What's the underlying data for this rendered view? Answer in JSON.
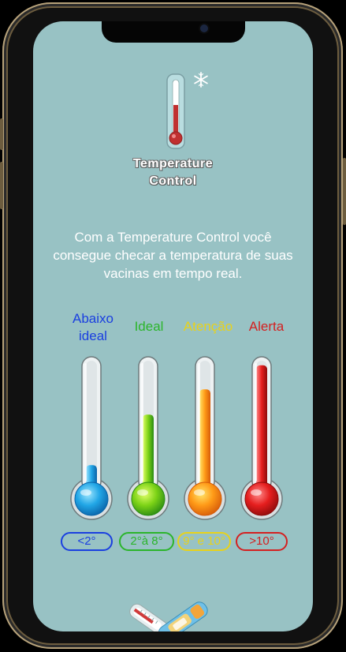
{
  "app": {
    "logo_line1": "Temperature",
    "logo_line2": "Control",
    "description": "Com a Temperature Control você consegue checar a temperatura de suas vacinas em tempo real."
  },
  "levels": [
    {
      "key": "low",
      "label_line1": "Abaixo",
      "label_line2": "ideal",
      "range": "<2°",
      "color": "#1a3fe0",
      "fill_fraction": 0.18
    },
    {
      "key": "ideal",
      "label_line1": "Ideal",
      "label_line2": "",
      "range": "2°à 8°",
      "color": "#2bb52b",
      "fill_fraction": 0.58
    },
    {
      "key": "attention",
      "label_line1": "Atenção",
      "label_line2": "",
      "range": "9° e 10°",
      "color": "#e8d21a",
      "fill_fraction": 0.78
    },
    {
      "key": "alert",
      "label_line1": "Alerta",
      "label_line2": "",
      "range": ">10°",
      "color": "#d42020",
      "fill_fraction": 0.97
    }
  ],
  "icons": {
    "logo": "thermometer-icon",
    "snow": "snowflake-icon",
    "bottom": "vaccine-illustration"
  },
  "colors": {
    "screen_bg": "#98c2c4",
    "frame_gold": "#b7a27a"
  }
}
